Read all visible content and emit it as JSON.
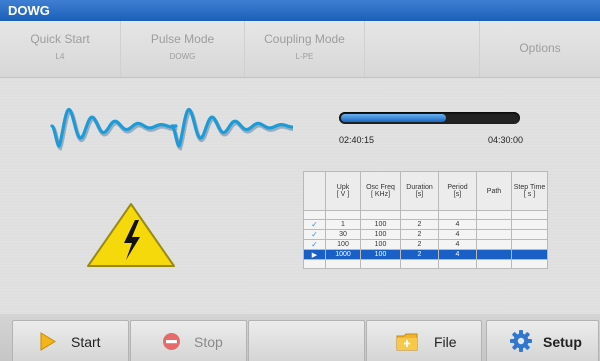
{
  "app": {
    "title": "DOWG"
  },
  "tabs": [
    {
      "label": "Quick Start",
      "sub": "L4"
    },
    {
      "label": "Pulse Mode",
      "sub": "DOWG"
    },
    {
      "label": "Coupling Mode",
      "sub": "L-PE"
    },
    {
      "label": "",
      "sub": ""
    },
    {
      "label": "Options",
      "sub": ""
    }
  ],
  "progress": {
    "elapsed": "02:40:15",
    "total": "04:30:00",
    "fraction": 0.593
  },
  "table": {
    "headers": [
      {
        "top": "",
        "bottom": ""
      },
      {
        "top": "Upk",
        "bottom": "[ V ]"
      },
      {
        "top": "Osc Freq",
        "bottom": "[ KHz]"
      },
      {
        "top": "Duration",
        "bottom": "[s]"
      },
      {
        "top": "Period",
        "bottom": "[s]"
      },
      {
        "top": "Path",
        "bottom": ""
      },
      {
        "top": "Step Time",
        "bottom": "[ s ]"
      }
    ],
    "rows": [
      {
        "marker": "✓",
        "cells": [
          "1",
          "100",
          "2",
          "4",
          "",
          ""
        ]
      },
      {
        "marker": "✓",
        "cells": [
          "30",
          "100",
          "2",
          "4",
          "",
          ""
        ]
      },
      {
        "marker": "✓",
        "cells": [
          "100",
          "100",
          "2",
          "4",
          "",
          ""
        ]
      },
      {
        "marker": "▶",
        "cells": [
          "1000",
          "100",
          "2",
          "4",
          "",
          ""
        ]
      }
    ]
  },
  "toolbar": {
    "start_label": "Start",
    "stop_label": "Stop",
    "file_label": "File",
    "setup_label": "Setup"
  },
  "colors": {
    "accent": "#1a5fc6",
    "wave": "#1e9bd7",
    "warning": "#f5d90a"
  }
}
